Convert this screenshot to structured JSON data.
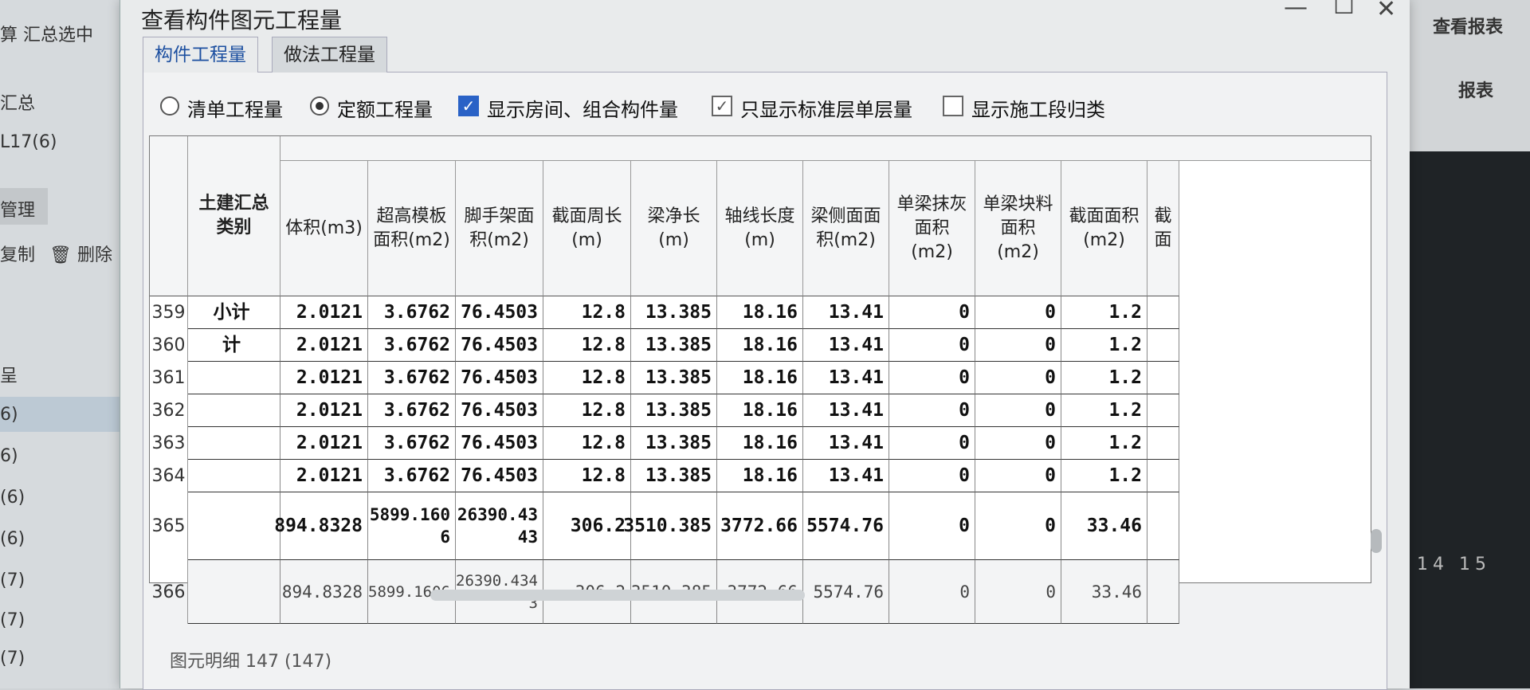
{
  "background": {
    "left_items": [
      "算  汇总选中",
      "汇总",
      "L17(6)",
      "管理",
      "复制",
      "删除",
      "呈",
      "6)",
      "6)",
      "(6)",
      "(6)",
      "(7)",
      "(7)",
      "(7)"
    ],
    "right_items": [
      "查看报表",
      "报表"
    ],
    "right_numbers": "14 15"
  },
  "dialog": {
    "title": "查看构件图元工程量",
    "tabs": [
      "构件工程量",
      "做法工程量"
    ],
    "options": {
      "radio_list": "清单工程量",
      "radio_quota": "定额工程量",
      "chk_room": "显示房间、组合构件量",
      "chk_standard": "只显示标准层单层量",
      "chk_stage": "显示施工段归类"
    },
    "footer": "图元明细  147 (147)"
  },
  "table": {
    "category_header": "土建汇总类别",
    "columns": [
      "体积(m3)",
      "超高模板面积(m2)",
      "脚手架面积(m2)",
      "截面周长(m)",
      "梁净长(m)",
      "轴线长度(m)",
      "梁侧面面积(m2)",
      "单梁抹灰面积(m2)",
      "单梁块料面积(m2)",
      "截面面积(m2)",
      "截面"
    ],
    "rows": [
      {
        "num": "359",
        "cat": "小计",
        "vals": [
          "2.0121",
          "3.6762",
          "76.4503",
          "12.8",
          "13.385",
          "18.16",
          "13.41",
          "0",
          "0",
          "1.2"
        ]
      },
      {
        "num": "360",
        "cat": "计",
        "vals": [
          "2.0121",
          "3.6762",
          "76.4503",
          "12.8",
          "13.385",
          "18.16",
          "13.41",
          "0",
          "0",
          "1.2"
        ]
      },
      {
        "num": "361",
        "cat": "",
        "vals": [
          "2.0121",
          "3.6762",
          "76.4503",
          "12.8",
          "13.385",
          "18.16",
          "13.41",
          "0",
          "0",
          "1.2"
        ]
      },
      {
        "num": "362",
        "cat": "",
        "vals": [
          "2.0121",
          "3.6762",
          "76.4503",
          "12.8",
          "13.385",
          "18.16",
          "13.41",
          "0",
          "0",
          "1.2"
        ]
      },
      {
        "num": "363",
        "cat": "",
        "vals": [
          "2.0121",
          "3.6762",
          "76.4503",
          "12.8",
          "13.385",
          "18.16",
          "13.41",
          "0",
          "0",
          "1.2"
        ]
      },
      {
        "num": "364",
        "cat": "",
        "vals": [
          "2.0121",
          "3.6762",
          "76.4503",
          "12.8",
          "13.385",
          "18.16",
          "13.41",
          "0",
          "0",
          "1.2"
        ]
      },
      {
        "num": "365",
        "cat": "",
        "vals": [
          "894.8328",
          "5899.1606",
          "26390.4343",
          "306.2",
          "3510.385",
          "3772.66",
          "5574.76",
          "0",
          "0",
          "33.46"
        ]
      },
      {
        "num": "366",
        "cat": "",
        "vals": [
          "894.8328",
          "5899.1606",
          "26390.4343",
          "306.2",
          "3510.385",
          "3772.66",
          "5574.76",
          "0",
          "0",
          "33.46"
        ]
      }
    ]
  }
}
